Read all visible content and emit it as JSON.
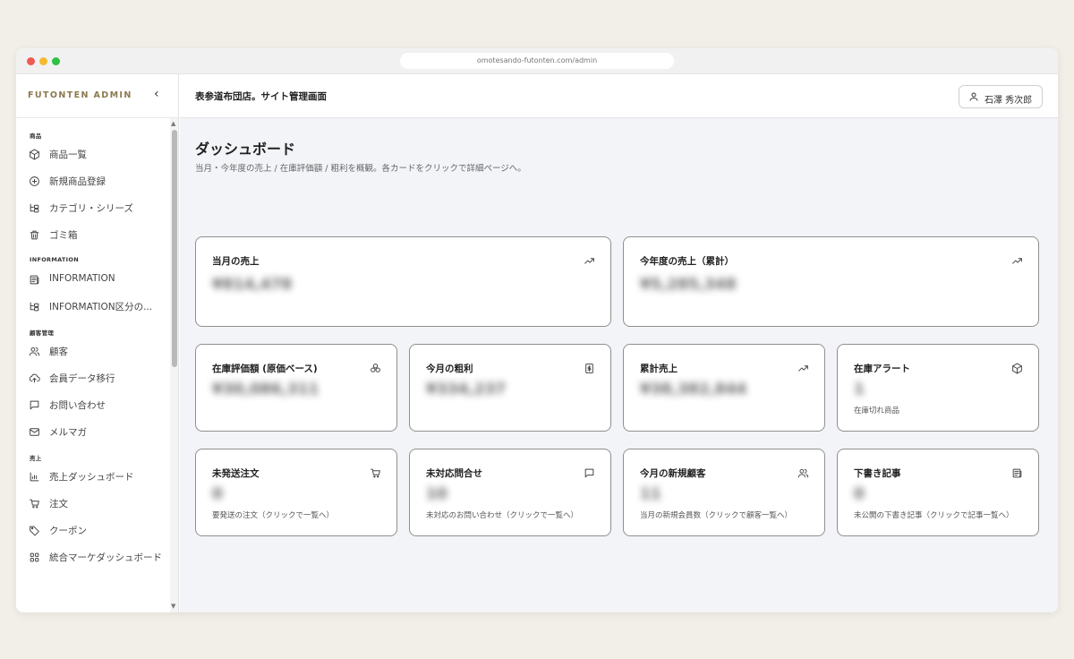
{
  "browser": {
    "url": "omotesando-futonten.com/admin"
  },
  "sidebar": {
    "brand": "FUTONTEN ADMIN",
    "collapse_icon": "chevron-left-icon",
    "sections": [
      {
        "title": "商品",
        "items": [
          {
            "label": "商品一覧",
            "icon": "box-icon"
          },
          {
            "label": "新規商品登録",
            "icon": "plus-circle-icon"
          },
          {
            "label": "カテゴリ・シリーズ",
            "icon": "tree-icon"
          },
          {
            "label": "ゴミ箱",
            "icon": "trash-icon"
          }
        ]
      },
      {
        "title": "INFORMATION",
        "items": [
          {
            "label": "INFORMATION",
            "icon": "newspaper-icon"
          },
          {
            "label": "INFORMATION区分の...",
            "icon": "tree-icon"
          }
        ]
      },
      {
        "title": "顧客管理",
        "items": [
          {
            "label": "顧客",
            "icon": "users-icon"
          },
          {
            "label": "会員データ移行",
            "icon": "cloud-upload-icon"
          },
          {
            "label": "お問い合わせ",
            "icon": "message-icon"
          },
          {
            "label": "メルマガ",
            "icon": "mail-icon"
          }
        ]
      },
      {
        "title": "売上",
        "items": [
          {
            "label": "売上ダッシュボード",
            "icon": "bar-chart-icon"
          },
          {
            "label": "注文",
            "icon": "cart-icon"
          },
          {
            "label": "クーポン",
            "icon": "tag-icon"
          },
          {
            "label": "統合マーケダッシュボード",
            "icon": "grid-icon"
          }
        ]
      }
    ]
  },
  "header": {
    "title": "表参道布団店。サイト管理画面",
    "user_name": "石澤 秀次郎"
  },
  "main": {
    "title": "ダッシュボード",
    "subtitle": "当月・今年度の売上 / 在庫評価額 / 粗利を概観。各カードをクリックで詳細ページへ。",
    "cards": [
      {
        "title": "当月の売上",
        "value": "¥814,478",
        "sub": "",
        "icon": "trending-up-icon"
      },
      {
        "title": "今年度の売上（累計）",
        "value": "¥5,285,348",
        "sub": "",
        "icon": "trending-up-icon"
      },
      {
        "title": "在庫評価額 (原価ベース)",
        "value": "¥30,086,311",
        "sub": "",
        "icon": "layers-icon"
      },
      {
        "title": "今月の粗利",
        "value": "¥334,237",
        "sub": "",
        "icon": "receipt-icon"
      },
      {
        "title": "累計売上",
        "value": "¥38,382,844",
        "sub": "",
        "icon": "trending-up-icon"
      },
      {
        "title": "在庫アラート",
        "value": "1",
        "sub": "在庫切れ商品",
        "icon": "cube-icon"
      },
      {
        "title": "未発送注文",
        "value": "0",
        "sub": "要発送の注文（クリックで一覧へ）",
        "icon": "cart-icon"
      },
      {
        "title": "未対応問合せ",
        "value": "10",
        "sub": "未対応のお問い合わせ（クリックで一覧へ）",
        "icon": "message-icon"
      },
      {
        "title": "今月の新規顧客",
        "value": "11",
        "sub": "当月の新規会員数（クリックで顧客一覧へ）",
        "icon": "users-icon"
      },
      {
        "title": "下書き記事",
        "value": "0",
        "sub": "未公開の下書き記事（クリックで記事一覧へ）",
        "icon": "newspaper-icon"
      }
    ]
  }
}
